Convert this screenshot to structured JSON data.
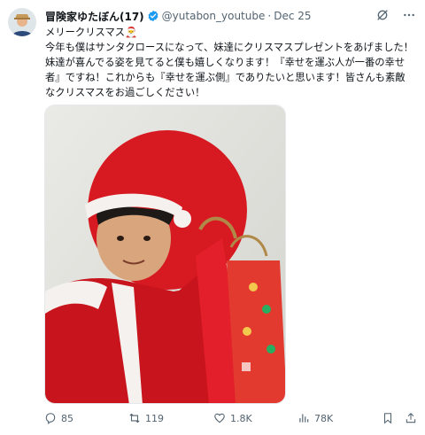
{
  "author": {
    "display_name": "冒険家ゆたぼん(17)",
    "handle": "@yutabon_youtube",
    "separator": "·",
    "date": "Dec 25"
  },
  "header_icons": [
    "grok-icon",
    "more-icon"
  ],
  "tweet": {
    "line1": "メリークリスマス🎅",
    "line2": "今年も僕はサンタクロースになって、妹達にクリスマスプレゼントをあげました！妹達が喜んでる姿を見てると僕も嬉しくなります！『幸せを運ぶ人が一番の幸せ者』ですね！これからも『幸せを運ぶ側』でありたいと思います！皆さんも素敵なクリスマスをお過ごしください！"
  },
  "actions": {
    "replies": "85",
    "retweets": "119",
    "likes": "1.8K",
    "views": "78K"
  },
  "colors": {
    "text": "#0f1419",
    "muted": "#536471",
    "verified": "#1d9bf0",
    "santa_red": "#d71a21"
  }
}
